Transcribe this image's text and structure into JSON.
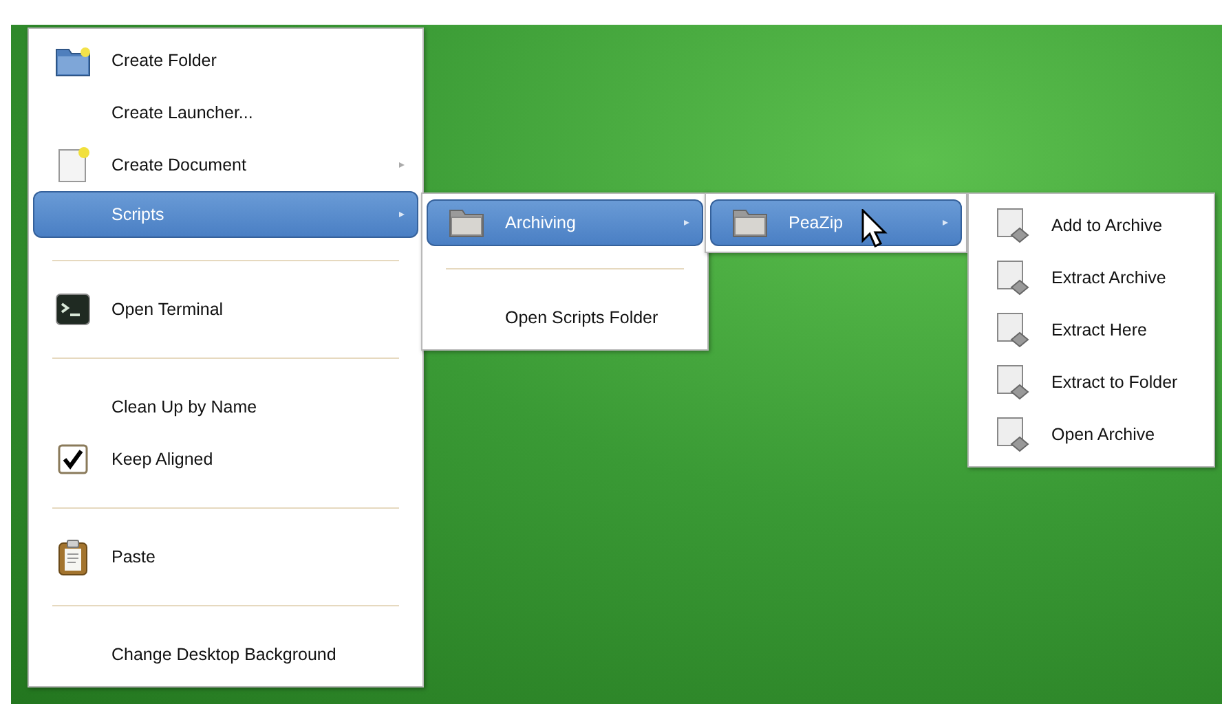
{
  "menus": [
    {
      "items": [
        {
          "kind": "folder",
          "label": "Create Folder",
          "selected": false,
          "submenu": false
        },
        {
          "kind": "plain",
          "label": "Create Launcher...",
          "selected": false,
          "submenu": false
        },
        {
          "kind": "document",
          "label": "Create Document",
          "selected": false,
          "submenu": true
        },
        {
          "kind": "plain",
          "label": "Scripts",
          "selected": true,
          "submenu": true
        },
        {
          "kind": "separator"
        },
        {
          "kind": "terminal",
          "label": "Open Terminal",
          "selected": false,
          "submenu": false
        },
        {
          "kind": "separator"
        },
        {
          "kind": "plain",
          "label": "Clean Up by Name",
          "selected": false,
          "submenu": false
        },
        {
          "kind": "check",
          "label": "Keep Aligned",
          "selected": false,
          "submenu": false,
          "checked": true
        },
        {
          "kind": "separator"
        },
        {
          "kind": "paste",
          "label": "Paste",
          "selected": false,
          "submenu": false
        },
        {
          "kind": "separator"
        },
        {
          "kind": "plain",
          "label": "Change Desktop Background",
          "selected": false,
          "submenu": false
        }
      ]
    },
    {
      "items": [
        {
          "kind": "folder-plain",
          "label": "Archiving",
          "selected": true,
          "submenu": true
        },
        {
          "kind": "separator"
        },
        {
          "kind": "plain",
          "label": "Open Scripts Folder",
          "selected": false,
          "submenu": false
        }
      ]
    },
    {
      "items": [
        {
          "kind": "folder-plain",
          "label": "PeaZip",
          "selected": true,
          "submenu": true
        }
      ]
    },
    {
      "items": [
        {
          "kind": "script",
          "label": "Add to Archive",
          "selected": false,
          "submenu": false
        },
        {
          "kind": "script",
          "label": "Extract Archive",
          "selected": false,
          "submenu": false
        },
        {
          "kind": "script",
          "label": "Extract Here",
          "selected": false,
          "submenu": false
        },
        {
          "kind": "script",
          "label": "Extract to Folder",
          "selected": false,
          "submenu": false
        },
        {
          "kind": "script",
          "label": "Open Archive",
          "selected": false,
          "submenu": false
        }
      ]
    }
  ]
}
